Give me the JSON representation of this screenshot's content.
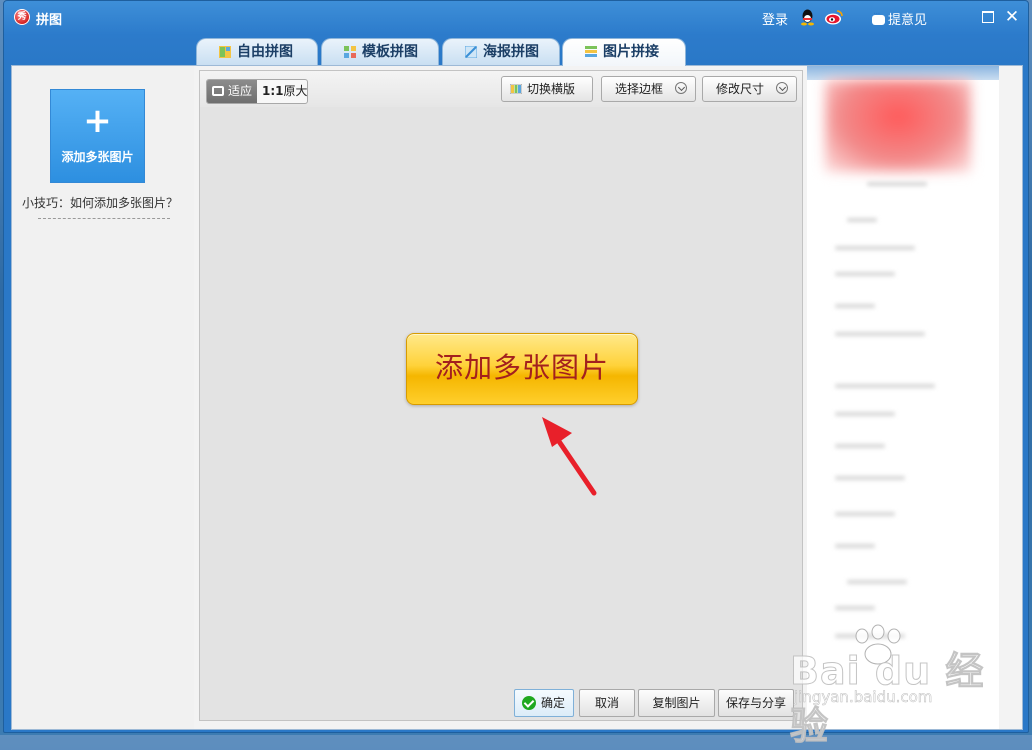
{
  "window": {
    "title": "拼图",
    "app_icon_text": "秀"
  },
  "titlebar": {
    "login": "登录",
    "qq_icon": "qq-icon",
    "weibo_icon": "weibo-icon",
    "feedback": "提意见"
  },
  "tabs": [
    {
      "label": "自由拼图",
      "icon": "free-collage-icon"
    },
    {
      "label": "模板拼图",
      "icon": "template-collage-icon"
    },
    {
      "label": "海报拼图",
      "icon": "poster-collage-icon"
    },
    {
      "label": "图片拼接",
      "icon": "image-join-icon",
      "active": true
    }
  ],
  "left_panel": {
    "add_tile_symbol": "+",
    "add_tile_label": "添加多张图片",
    "tip": "小技巧：如何添加多张图片？"
  },
  "canvas": {
    "zoom_fit": "适应",
    "zoom_ratio": "1:1",
    "zoom_original": "原大",
    "toolbar": {
      "switch_layout": "切换横版",
      "select_border": "选择边框",
      "resize": "修改尺寸"
    },
    "center_button": "添加多张图片"
  },
  "bottom_buttons": {
    "confirm": "确定",
    "cancel": "取消",
    "copy": "复制图片",
    "save_share": "保存与分享"
  },
  "watermark": {
    "brand": "Bai du 经验",
    "url": "jingyan.baidu.com"
  },
  "colors": {
    "accent_blue": "#2c7bcb",
    "center_button_yellow": "#ffd23a",
    "center_button_text": "#a3201e",
    "arrow_red": "#e8202a"
  }
}
